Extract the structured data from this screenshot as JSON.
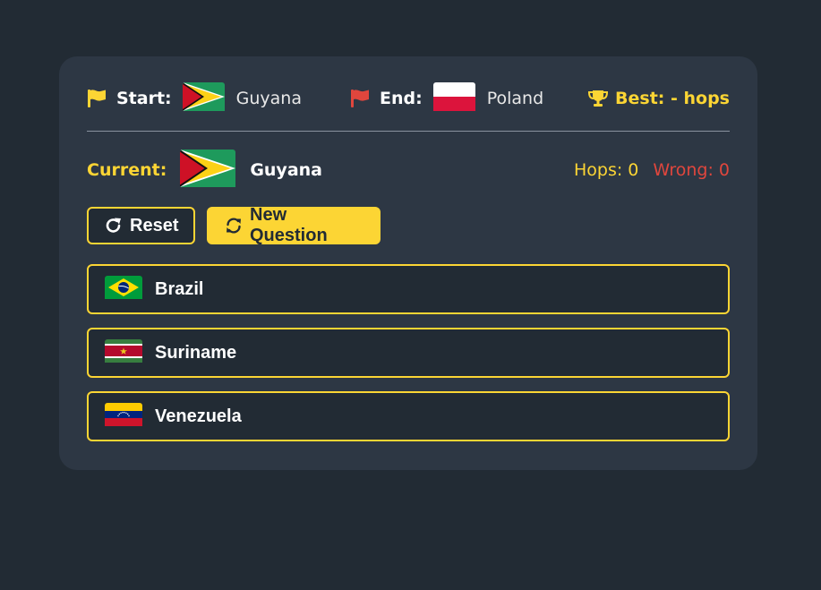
{
  "header": {
    "start_label": "Start:",
    "start_country": "Guyana",
    "end_label": "End:",
    "end_country": "Poland",
    "best_text": "Best: - hops"
  },
  "current": {
    "label": "Current:",
    "country": "Guyana"
  },
  "stats": {
    "hops_text": "Hops: 0",
    "wrong_text": "Wrong: 0"
  },
  "buttons": {
    "reset_label": "Reset",
    "new_question_label": "New Question"
  },
  "options": [
    {
      "label": "Brazil",
      "flag": "brazil-flag"
    },
    {
      "label": "Suriname",
      "flag": "suriname-flag"
    },
    {
      "label": "Venezuela",
      "flag": "venezuela-flag"
    }
  ],
  "colors": {
    "background": "#222b34",
    "card": "#2d3744",
    "accent_yellow": "#fcd534",
    "wrong_red": "#e0463d",
    "start_flag_icon": "#fcd534",
    "end_flag_icon": "#e0463d"
  },
  "icons": {
    "start": "flag-icon",
    "end": "flag-icon",
    "best": "trophy-icon",
    "reset": "rotate-right-icon",
    "new_question": "sync-icon"
  }
}
